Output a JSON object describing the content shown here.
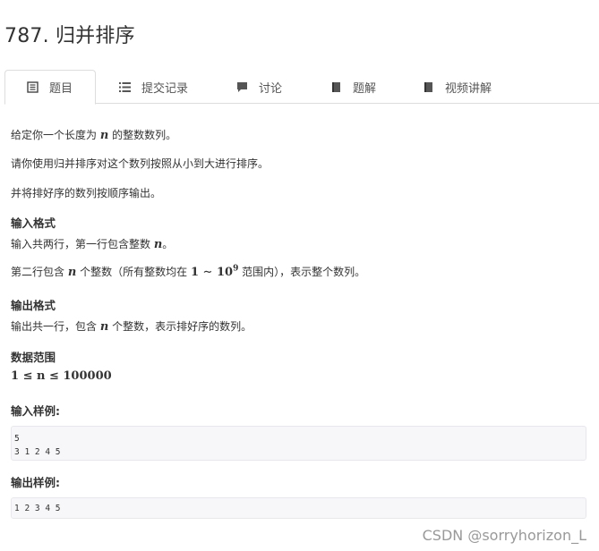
{
  "title": "787. 归并排序",
  "tabs": [
    {
      "label": "题目",
      "icon": "document-icon",
      "active": true
    },
    {
      "label": "提交记录",
      "icon": "list-icon",
      "active": false
    },
    {
      "label": "讨论",
      "icon": "comment-icon",
      "active": false
    },
    {
      "label": "题解",
      "icon": "book-icon",
      "active": false
    },
    {
      "label": "视频讲解",
      "icon": "book-icon",
      "active": false
    }
  ],
  "problem": {
    "desc1_pre": "给定你一个长度为",
    "desc1_var": "n",
    "desc1_post": "的整数数列。",
    "desc2": "请你使用归并排序对这个数列按照从小到大进行排序。",
    "desc3": "并将排好序的数列按顺序输出。",
    "input_heading": "输入格式",
    "input1_pre": "输入共两行，第一行包含整数",
    "input1_var": "n",
    "input1_post": "。",
    "input2_pre": "第二行包含",
    "input2_var": "n",
    "input2_mid": "个整数（所有整数均在",
    "input2_range": "1 ∼ 10",
    "input2_exp": "9",
    "input2_post": "范围内），表示整个数列。",
    "output_heading": "输出格式",
    "output1_pre": "输出共一行，包含",
    "output1_var": "n",
    "output1_post": "个整数，表示排好序的数列。",
    "range_heading": "数据范围",
    "range_text": "1 ≤ n ≤ 100000",
    "sample_input_heading": "输入样例:",
    "sample_input": "5\n3 1 2 4 5",
    "sample_output_heading": "输出样例:",
    "sample_output": "1 2 3 4 5"
  },
  "watermark": "CSDN @sorryhorizon_L"
}
